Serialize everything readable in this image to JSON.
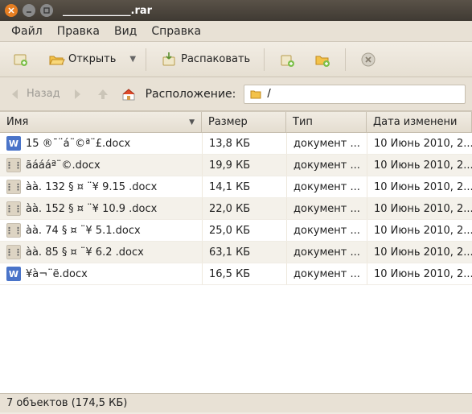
{
  "window": {
    "title": "_____________.rar"
  },
  "menu": {
    "file": "Файл",
    "edit": "Правка",
    "view": "Вид",
    "help": "Справка"
  },
  "toolbar": {
    "open": "Открыть",
    "extract": "Распаковать"
  },
  "nav": {
    "back": "Назад",
    "location_label": "Расположение:",
    "location_value": "/"
  },
  "columns": {
    "name": "Имя",
    "size": "Размер",
    "type": "Тип",
    "date": "Дата изменени"
  },
  "rows": [
    {
      "icon": "docx",
      "name": "15 ®¯¨á¨©ª¨£.docx",
      "size": "13,8 КБ",
      "type": "документ ...",
      "date": "10 Июнь 2010, 2..."
    },
    {
      "icon": "generic",
      "name": "ãáááª¨©.docx",
      "size": "19,9 КБ",
      "type": "документ ...",
      "date": "10 Июнь 2010, 2..."
    },
    {
      "icon": "generic",
      "name": "àà. 132 § ¤ ¨¥ 9.15 .docx",
      "size": "14,1 КБ",
      "type": "документ ...",
      "date": "10 Июнь 2010, 2..."
    },
    {
      "icon": "generic",
      "name": "àà. 152 § ¤ ¨¥ 10.9 .docx",
      "size": "22,0 КБ",
      "type": "документ ...",
      "date": "10 Июнь 2010, 2..."
    },
    {
      "icon": "generic",
      "name": "àà. 74 § ¤ ¨¥ 5.1.docx",
      "size": "25,0 КБ",
      "type": "документ ...",
      "date": "10 Июнь 2010, 2..."
    },
    {
      "icon": "generic",
      "name": "àà. 85 § ¤ ¨¥ 6.2 .docx",
      "size": "63,1 КБ",
      "type": "документ ...",
      "date": "10 Июнь 2010, 2..."
    },
    {
      "icon": "docx",
      "name": "¥à¬¨ë.docx",
      "size": "16,5 КБ",
      "type": "документ ...",
      "date": "10 Июнь 2010, 2..."
    }
  ],
  "status": "7 объектов (174,5 КБ)"
}
